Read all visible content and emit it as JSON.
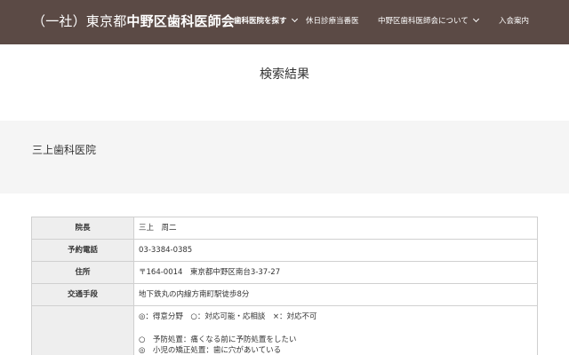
{
  "header": {
    "logo_prefix": "（一社）東京都",
    "logo_brand": "中野区歯科医師会",
    "nav": [
      {
        "label": "歯科医院を探す"
      },
      {
        "label": "休日診療当番医"
      },
      {
        "label": "中野区歯科医師会について"
      },
      {
        "label": "入会案内"
      }
    ]
  },
  "page": {
    "title": "検索結果"
  },
  "clinic": {
    "name": "三上歯科医院"
  },
  "info": {
    "rows": [
      {
        "label": "院長",
        "value": "三上　周二"
      },
      {
        "label": "予約電話",
        "value": "03-3384-0385"
      },
      {
        "label": "住所",
        "value": "〒164-0014　東京都中野区南台3-37-27"
      },
      {
        "label": "交通手段",
        "value": "地下鉄丸の内線方南町駅徒歩8分"
      }
    ],
    "services": {
      "legend": "◎：得意分野　○：対応可能・応相談　×：対応不可",
      "items": [
        "○　予防処置：痛くなる前に予防処置をしたい",
        "◎　小児の矯正処置：歯に穴があいている"
      ]
    }
  }
}
